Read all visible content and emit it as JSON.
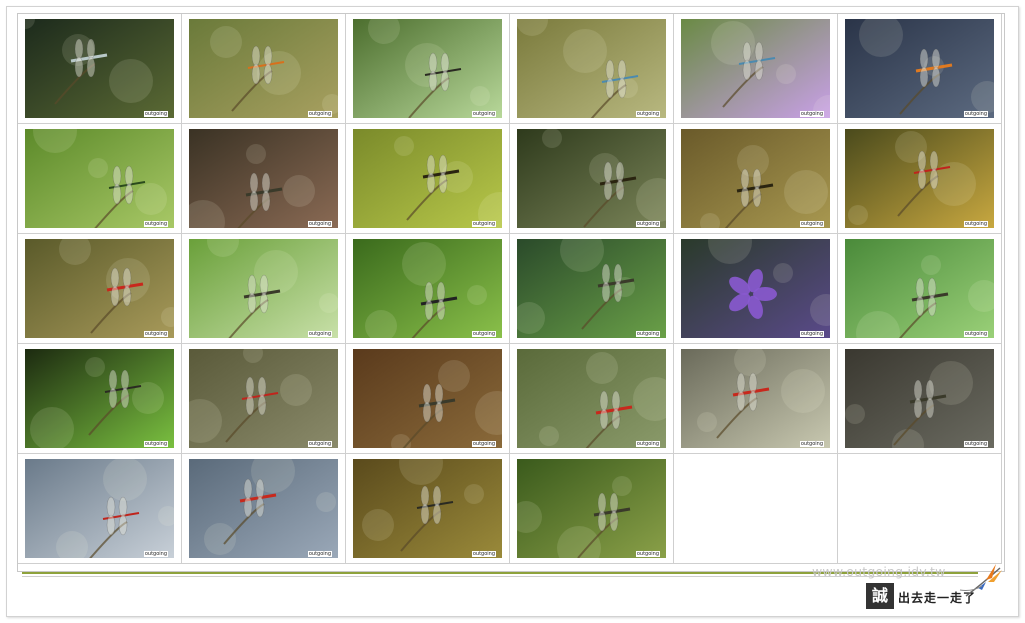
{
  "footer": {
    "site_url": "www.outgoing.idv.tw",
    "logo_mark": "誠",
    "logo_text": "出去走一走了"
  },
  "thumbnails": [
    {
      "name": "damselfly-over-pond-reflection",
      "bg": [
        "#1c2a1c",
        "#5b6a34"
      ],
      "subject": "dragonfly-pale"
    },
    {
      "name": "orange-damselfly-on-moss",
      "bg": [
        "#6a7a3a",
        "#a8a060"
      ],
      "subject": "damsel-orange"
    },
    {
      "name": "damselfly-on-grass-blades",
      "bg": [
        "#4c6e2e",
        "#b8d89a"
      ],
      "subject": "damsel-dark"
    },
    {
      "name": "blue-damselfly-over-water",
      "bg": [
        "#7a7a3c",
        "#b8b880"
      ],
      "subject": "damsel-blue"
    },
    {
      "name": "blue-damselfly-near-lotus",
      "bg": [
        "#6a8a44",
        "#c9a0e8"
      ],
      "subject": "damsel-blue"
    },
    {
      "name": "orange-dragonfly-dark-background",
      "bg": [
        "#2a3448",
        "#5c6a80"
      ],
      "subject": "dragon-orange"
    },
    {
      "name": "green-damselfly-on-leaf",
      "bg": [
        "#5c8a2a",
        "#a8c866"
      ],
      "subject": "damsel-green"
    },
    {
      "name": "dragonfly-on-rock",
      "bg": [
        "#3a3224",
        "#8a6a54"
      ],
      "subject": "dragon-dark"
    },
    {
      "name": "yellow-striped-dragonfly-on-leaf",
      "bg": [
        "#7a8a2a",
        "#b8c84a"
      ],
      "subject": "dragon-yellow"
    },
    {
      "name": "yellow-dragonfly-on-stem",
      "bg": [
        "#2e3a1c",
        "#7a8458"
      ],
      "subject": "dragon-yellow"
    },
    {
      "name": "yellow-striped-dragonfly-on-grass",
      "bg": [
        "#6a5a2a",
        "#a89850"
      ],
      "subject": "dragon-yellow"
    },
    {
      "name": "red-damselfly-yellow-bokeh",
      "bg": [
        "#4a4a1c",
        "#c8a840"
      ],
      "subject": "damsel-red"
    },
    {
      "name": "red-dragonfly-on-twig",
      "bg": [
        "#5a5a2a",
        "#a89a5a"
      ],
      "subject": "dragon-red"
    },
    {
      "name": "dragonfly-on-green-leaf",
      "bg": [
        "#6aa03a",
        "#c8e0a8"
      ],
      "subject": "dragon-dark"
    },
    {
      "name": "striped-dragonfly-on-grass",
      "bg": [
        "#3a6a1c",
        "#8ac04a"
      ],
      "subject": "dragon-striped"
    },
    {
      "name": "dragonfly-over-lily-pads",
      "bg": [
        "#2a4a2a",
        "#6aa048"
      ],
      "subject": "dragon-dark"
    },
    {
      "name": "purple-flower-with-insect",
      "bg": [
        "#2a3a2a",
        "#5a4a8a"
      ],
      "subject": "flower-purple"
    },
    {
      "name": "dragonfly-on-bent-stem",
      "bg": [
        "#4a8a3a",
        "#9ad078"
      ],
      "subject": "dragon-dark"
    },
    {
      "name": "damselfly-on-lotus-leaf",
      "bg": [
        "#1c2a10",
        "#7ac040"
      ],
      "subject": "damsel-dark"
    },
    {
      "name": "red-damselfly-on-twig",
      "bg": [
        "#5a5a3a",
        "#8a8a6a"
      ],
      "subject": "damsel-red"
    },
    {
      "name": "dragonfly-on-crossed-stems",
      "bg": [
        "#5a3a1c",
        "#8a6a3a"
      ],
      "subject": "dragon-dark"
    },
    {
      "name": "red-dragonfly-bokeh-flowers",
      "bg": [
        "#5a6a3a",
        "#8a9a6a"
      ],
      "subject": "dragon-red"
    },
    {
      "name": "red-dragonfly-on-leaf-tip",
      "bg": [
        "#6a6a5a",
        "#c8c8b0"
      ],
      "subject": "dragon-red"
    },
    {
      "name": "dragonfly-on-curved-stem",
      "bg": [
        "#3a3830",
        "#6a6a60"
      ],
      "subject": "dragon-dark"
    },
    {
      "name": "red-damselfly-grey-bokeh",
      "bg": [
        "#6a7a8a",
        "#c8d0d8"
      ],
      "subject": "damsel-red"
    },
    {
      "name": "red-dragonfly-blue-bokeh",
      "bg": [
        "#5a6a7a",
        "#9aa8b8"
      ],
      "subject": "dragon-red"
    },
    {
      "name": "damselfly-on-curled-leaf",
      "bg": [
        "#5a4a1c",
        "#9a8a3a"
      ],
      "subject": "damsel-dark"
    },
    {
      "name": "dragonfly-on-dried-stem",
      "bg": [
        "#3a5a1c",
        "#8aa048"
      ],
      "subject": "dragon-dark"
    },
    {
      "name": "empty",
      "bg": null,
      "subject": null
    },
    {
      "name": "empty",
      "bg": null,
      "subject": null
    }
  ],
  "thumbnail_watermark": "outgoing"
}
